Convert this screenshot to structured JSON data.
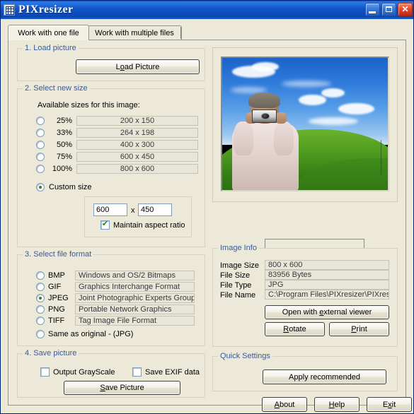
{
  "window": {
    "title": "PIXresizer",
    "icon": "pixel-grid-icon",
    "buttons": {
      "minimize": "minimize",
      "maximize": "maximize",
      "close": "close"
    }
  },
  "tabs": [
    {
      "label": "Work with one file",
      "active": true
    },
    {
      "label": "Work with multiple files",
      "active": false
    }
  ],
  "load_picture": {
    "group_title": "1. Load picture",
    "button_label": "Load Picture",
    "button_accel": "o"
  },
  "select_new_size": {
    "group_title": "2. Select new size",
    "available_label": "Available sizes for this image:",
    "presets": [
      {
        "percent": "25%",
        "size": "200 x 150",
        "selected": false
      },
      {
        "percent": "33%",
        "size": "264 x 198",
        "selected": false
      },
      {
        "percent": "50%",
        "size": "400 x 300",
        "selected": false
      },
      {
        "percent": "75%",
        "size": "600 x 450",
        "selected": false
      },
      {
        "percent": "100%",
        "size": "800 x 600",
        "selected": false
      }
    ],
    "custom_size_label": "Custom size",
    "custom_selected": true,
    "width_value": "600",
    "separator": "x",
    "height_value": "450",
    "maintain_aspect_label": "Maintain aspect ratio",
    "maintain_aspect_checked": true
  },
  "select_file_format": {
    "group_title": "3. Select file format",
    "formats": [
      {
        "name": "BMP",
        "description": "Windows and OS/2 Bitmaps",
        "selected": false
      },
      {
        "name": "GIF",
        "description": "Graphics Interchange Format",
        "selected": false
      },
      {
        "name": "JPEG",
        "description": "Joint Photographic Experts Group",
        "selected": true
      },
      {
        "name": "PNG",
        "description": "Portable Network Graphics",
        "selected": false
      },
      {
        "name": "TIFF",
        "description": "Tag Image File Format",
        "selected": false
      }
    ],
    "same_as_original_label": "Same as original  - (JPG)",
    "same_as_original_selected": false
  },
  "save_picture": {
    "group_title": "4. Save picture",
    "grayscale_label": "Output GrayScale",
    "grayscale_checked": false,
    "exif_label": "Save EXIF data",
    "exif_checked": false,
    "button_label": "Save Picture",
    "button_accel": "S"
  },
  "preview": {
    "name": "image-preview",
    "alt": "Man holding camera in front of green hill and blue sky"
  },
  "image_info": {
    "group_title": "Image Info",
    "rows": [
      {
        "label": "Image Size",
        "value": "800 x 600"
      },
      {
        "label": "File Size",
        "value": "83956 Bytes"
      },
      {
        "label": "File Type",
        "value": "JPG"
      },
      {
        "label": "File Name",
        "value": "C:\\Program Files\\PIXresizer\\PIXresiz"
      }
    ],
    "open_external_label": "Open with external viewer",
    "open_external_accel": "e",
    "rotate_label": "Rotate",
    "rotate_accel": "R",
    "print_label": "Print",
    "print_accel": "P"
  },
  "quick_settings": {
    "group_title": "Quick Settings",
    "apply_label": "Apply recommended"
  },
  "bottom_buttons": [
    {
      "label": "About",
      "accel": "A"
    },
    {
      "label": "Help",
      "accel": "H"
    },
    {
      "label": "Exit",
      "accel": "x"
    }
  ],
  "colors": {
    "window_bg": "#ece9d8",
    "group_title": "#3b5998",
    "titlebar": "#1255c8",
    "close_button": "#c0392b",
    "radio_dot": "#3c7a28",
    "check_mark": "#2f7d1f"
  }
}
